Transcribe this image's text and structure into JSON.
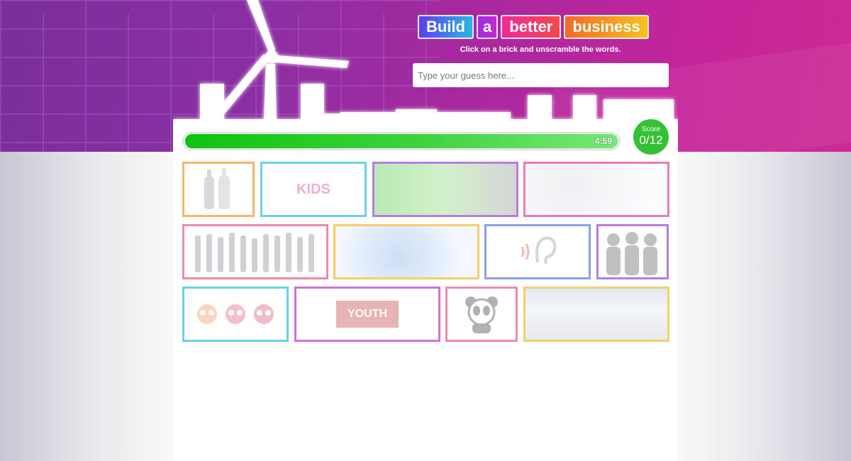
{
  "title": {
    "words": [
      {
        "text": "Build",
        "color_start": "#5b3ef0",
        "color_end": "#2bb6e0"
      },
      {
        "text": "a",
        "color_start": "#9b2fe0",
        "color_end": "#c32ad0"
      },
      {
        "text": "better",
        "color_start": "#ee2a9a",
        "color_end": "#f04a4a"
      },
      {
        "text": "business",
        "color_start": "#f06a28",
        "color_end": "#f6c21c"
      }
    ]
  },
  "subtitle": "Click on a brick and unscramble the words.",
  "guess_input": {
    "placeholder": "Type your guess here...",
    "value": ""
  },
  "timer": {
    "text": "4:59",
    "progress": 1.0
  },
  "score": {
    "label": "Score",
    "value": "0/12"
  },
  "bricks": [
    {
      "name": "brick-bottles",
      "border": "#f5b66a",
      "icon": "bottles-icon"
    },
    {
      "name": "brick-sky-kids",
      "border": "#6ad2e8",
      "icon": "sky-kids-logo-icon",
      "logo_text": "KIDS"
    },
    {
      "name": "brick-film-people",
      "border": "#b77ee0",
      "icon": "film-people-icon"
    },
    {
      "name": "brick-texture",
      "border": "#ec7ab8",
      "icon": "texture-icon"
    },
    {
      "name": "brick-group-people",
      "border": "#ef8aa8",
      "icon": "group-people-icon"
    },
    {
      "name": "brick-hand-blue",
      "border": "#f5cf6a",
      "icon": "hand-icon"
    },
    {
      "name": "brick-hearing",
      "border": "#8aa0e8",
      "icon": "ear-icon"
    },
    {
      "name": "brick-women",
      "border": "#b77ee0",
      "icon": "women-icon"
    },
    {
      "name": "brick-owls",
      "border": "#6ad2e8",
      "icon": "owls-icon"
    },
    {
      "name": "brick-media-youth",
      "border": "#d070d8",
      "icon": "media-youth-logo-icon",
      "logo_text": "YOUTH"
    },
    {
      "name": "brick-panda",
      "border": "#f08ab0",
      "icon": "panda-icon"
    },
    {
      "name": "brick-building",
      "border": "#f5cf6a",
      "icon": "building-icon"
    }
  ]
}
